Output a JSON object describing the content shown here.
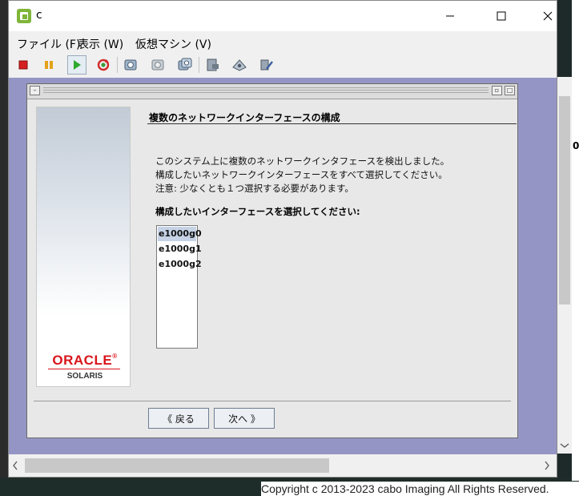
{
  "window": {
    "title": "c",
    "controls": {
      "minimize": "—",
      "maximize": "☐",
      "close": "✕"
    }
  },
  "menu": [
    "ファイル (F)",
    "表示 (W)",
    "仮想マシン (V)"
  ],
  "toolbar": {
    "icons": [
      "stop-icon",
      "pause-icon",
      "play-icon",
      "reset-icon",
      "snapshot-icon",
      "revert-snapshot-icon",
      "manage-snapshots-icon",
      "settings-icon",
      "console-icon",
      "tools-icon"
    ]
  },
  "installer": {
    "brand": "ORACLE",
    "brand_mark": "®",
    "product": "SOLARIS",
    "heading": "複数のネットワークインターフェースの構成",
    "messages": [
      "このシステム上に複数のネットワークインタフェースを検出しました。",
      "構成したいネットワークインターフェースをすべて選択してください。",
      "注意: 少なくとも１つ選択する必要があります。"
    ],
    "prompt": "構成したいインターフェースを選択してください:",
    "interfaces": [
      "e1000g0",
      "e1000g1",
      "e1000g2"
    ],
    "selected_index": 0,
    "back_button": "《 戻る",
    "next_button": "次へ 》"
  },
  "background": {
    "copyright": "Copyright c 2013-2023 cabo Imaging All Rights Reserved.",
    "right_edge_text": "0"
  },
  "colors": {
    "console_bg": "#9595c5",
    "selection": "#c6d3e6",
    "oracle_red": "#d8151b"
  }
}
